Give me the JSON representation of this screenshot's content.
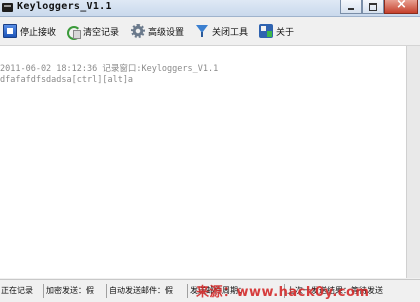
{
  "window": {
    "title": "Keyloggers_V1.1"
  },
  "toolbar": {
    "stop_label": "停止接收",
    "clear_label": "清空记录",
    "settings_label": "高级设置",
    "close_tool_label": "关闭工具",
    "about_label": "关于"
  },
  "log": {
    "lines": [
      "2011-06-02 18:12:36 记录窗口:Keyloggers_V1.1",
      "dfafafdfsdadsa[ctrl][alt]a"
    ]
  },
  "statusbar": {
    "recording": "正在记录",
    "encrypt_send": "加密发送：假",
    "auto_send": "自动发送邮件：假",
    "send_cycle": "发送邮件周期：",
    "last_result": "上次一发送结果：等待发送"
  },
  "watermark": {
    "text": "来源：www.hack0y.com"
  }
}
